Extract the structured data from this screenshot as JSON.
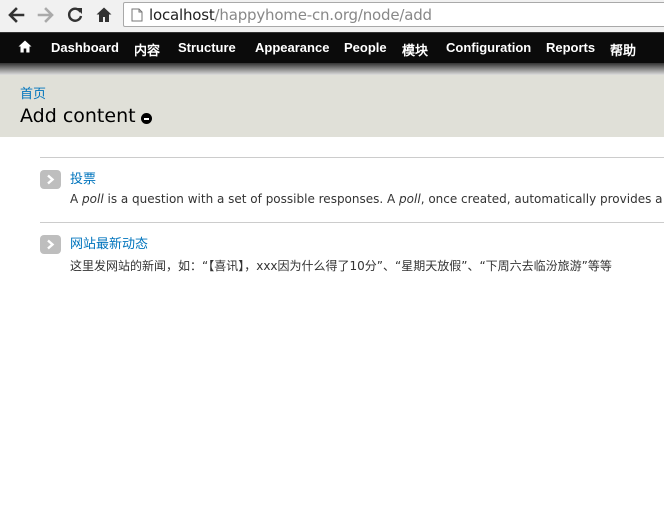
{
  "browser": {
    "url_host": "localhost",
    "url_path": "/happyhome-cn.org/node/add"
  },
  "toolbar": {
    "items": [
      "Dashboard",
      "内容",
      "Structure",
      "Appearance",
      "People",
      "模块",
      "Configuration",
      "Reports",
      "帮助"
    ]
  },
  "header": {
    "breadcrumb": "首页",
    "title": "Add content"
  },
  "content_types": [
    {
      "name": "投票",
      "desc_parts": [
        "A ",
        "poll",
        " is a question with a set of possible responses. A ",
        "poll",
        ", once created, automatically provides a sim"
      ]
    },
    {
      "name": "网站最新动态",
      "description": "这里发网站的新闻，如：“【喜讯】，xxx因为什么得了10分”、“星期天放假”、“下周六去临汾旅游”等等"
    }
  ]
}
